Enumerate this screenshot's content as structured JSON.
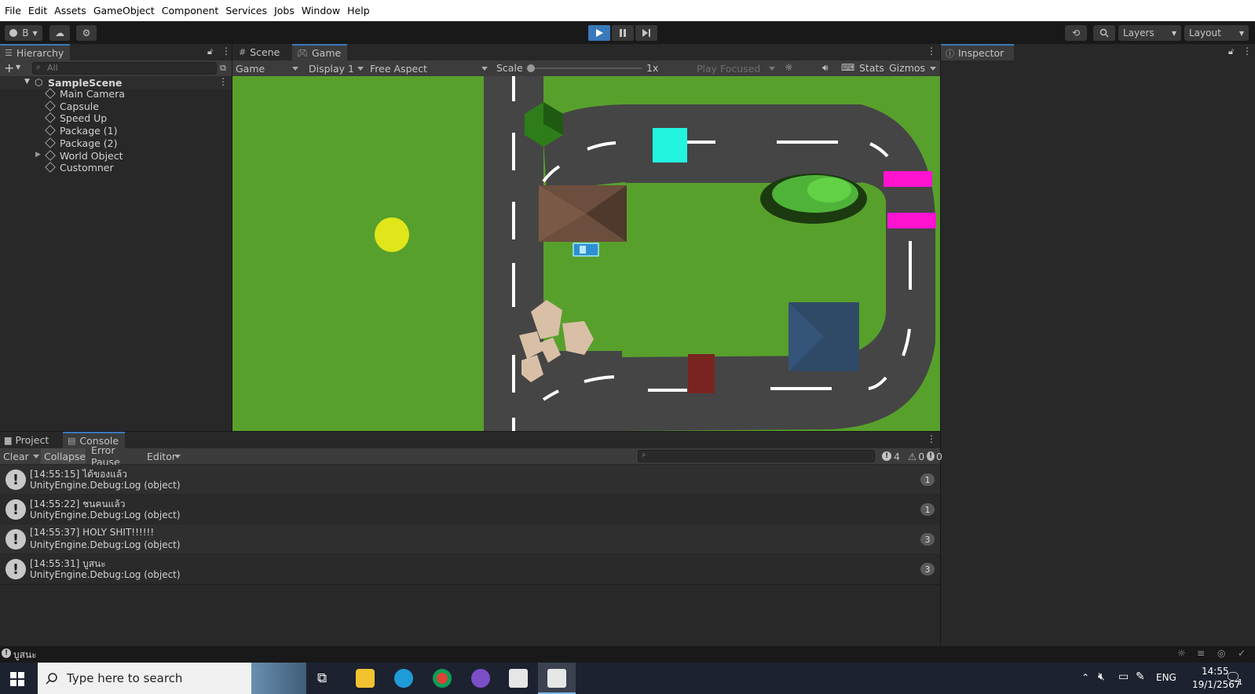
{
  "menu": [
    "File",
    "Edit",
    "Assets",
    "GameObject",
    "Component",
    "Services",
    "Jobs",
    "Window",
    "Help"
  ],
  "toolbar": {
    "account_label": "B",
    "layers_label": "Layers",
    "layout_label": "Layout"
  },
  "hierarchy": {
    "tab_label": "Hierarchy",
    "search_placeholder": "All",
    "scene_name": "SampleScene",
    "items": [
      "Main Camera",
      "Capsule",
      "Speed Up",
      "Package (1)",
      "Package (2)",
      "World Object",
      "Customner"
    ]
  },
  "viewport": {
    "tabs": [
      "Scene",
      "Game"
    ],
    "active_tab": "Game",
    "game_dropdown": "Game",
    "display_dropdown": "Display 1",
    "aspect_dropdown": "Free Aspect",
    "scale_label": "Scale",
    "scale_value": "1x",
    "play_mode_dropdown": "Play Focused",
    "stats_label": "Stats",
    "gizmos_label": "Gizmos"
  },
  "inspector": {
    "tab_label": "Inspector"
  },
  "bottom_panel": {
    "tabs": [
      "Project",
      "Console"
    ],
    "active_tab": "Console",
    "clear_label": "Clear",
    "collapse_label": "Collapse",
    "error_pause_label": "Error Pause",
    "editor_label": "Editor",
    "info_count": "4",
    "warn_count": "0",
    "error_count": "0"
  },
  "console_logs": [
    {
      "line1": "[14:55:15] ได้ของแล้ว",
      "line2": "UnityEngine.Debug:Log (object)",
      "count": "1"
    },
    {
      "line1": "[14:55:22] ชนคนแล้ว",
      "line2": "UnityEngine.Debug:Log (object)",
      "count": "1"
    },
    {
      "line1": "[14:55:37] HOLY SHIT!!!!!!",
      "line2": "UnityEngine.Debug:Log (object)",
      "count": "3"
    },
    {
      "line1": "[14:55:31] บูสนะ",
      "line2": "UnityEngine.Debug:Log (object)",
      "count": "3"
    }
  ],
  "status_bar": {
    "message": "บูสนะ"
  },
  "taskbar": {
    "search_placeholder": "Type here to search",
    "language": "ENG",
    "time": "14:55",
    "date": "19/1/2567",
    "notification_count": "1"
  },
  "colors": {
    "grass": "#58a02c",
    "road": "#454545",
    "accent_blue": "#3a79bb",
    "cyan_package": "#22f4e0",
    "magenta_customer": "#ff13d0",
    "yellow_speedup": "#e0e61a"
  }
}
